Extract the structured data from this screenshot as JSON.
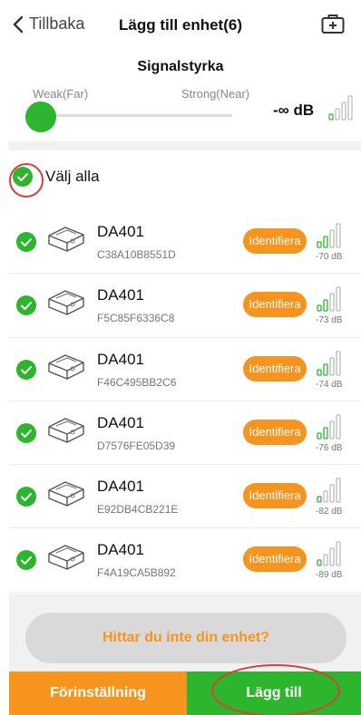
{
  "header": {
    "back_label": "Tillbaka",
    "title": "Lägg till enhet(6)",
    "right_icon": "medical-kit-icon"
  },
  "signal": {
    "title": "Signalstyrka",
    "weak_label": "Weak(Far)",
    "strong_label": "Strong(Near)",
    "threshold": "-∞ dB",
    "slider_level": 0
  },
  "select_all": {
    "label": "Välj alla",
    "checked": true
  },
  "devices": [
    {
      "name": "DA401",
      "mac": "C38A10B8551D",
      "identify_label": "Identifiera",
      "rssi": "-70 dB",
      "bars": 2,
      "checked": true
    },
    {
      "name": "DA401",
      "mac": "F5C85F6336C8",
      "identify_label": "Identifiera",
      "rssi": "-73 dB",
      "bars": 2,
      "checked": true
    },
    {
      "name": "DA401",
      "mac": "F46C495BB2C6",
      "identify_label": "Identifiera",
      "rssi": "-74 dB",
      "bars": 2,
      "checked": true
    },
    {
      "name": "DA401",
      "mac": "D7576FE05D39",
      "identify_label": "Identifiera",
      "rssi": "-76 dB",
      "bars": 2,
      "checked": true
    },
    {
      "name": "DA401",
      "mac": "E92DB4CB221E",
      "identify_label": "Identifiera",
      "rssi": "-82 dB",
      "bars": 1,
      "checked": true
    },
    {
      "name": "DA401",
      "mac": "F4A19CA5B892",
      "identify_label": "Identifiera",
      "rssi": "-89 dB",
      "bars": 1,
      "checked": true
    }
  ],
  "footer": {
    "find_label": "Hittar du inte din enhet?",
    "preset_label": "Förinställning",
    "add_label": "Lägg till"
  },
  "colors": {
    "accent_green": "#2db52d",
    "accent_orange": "#f7941d",
    "annotation_red": "#e03b3b"
  }
}
